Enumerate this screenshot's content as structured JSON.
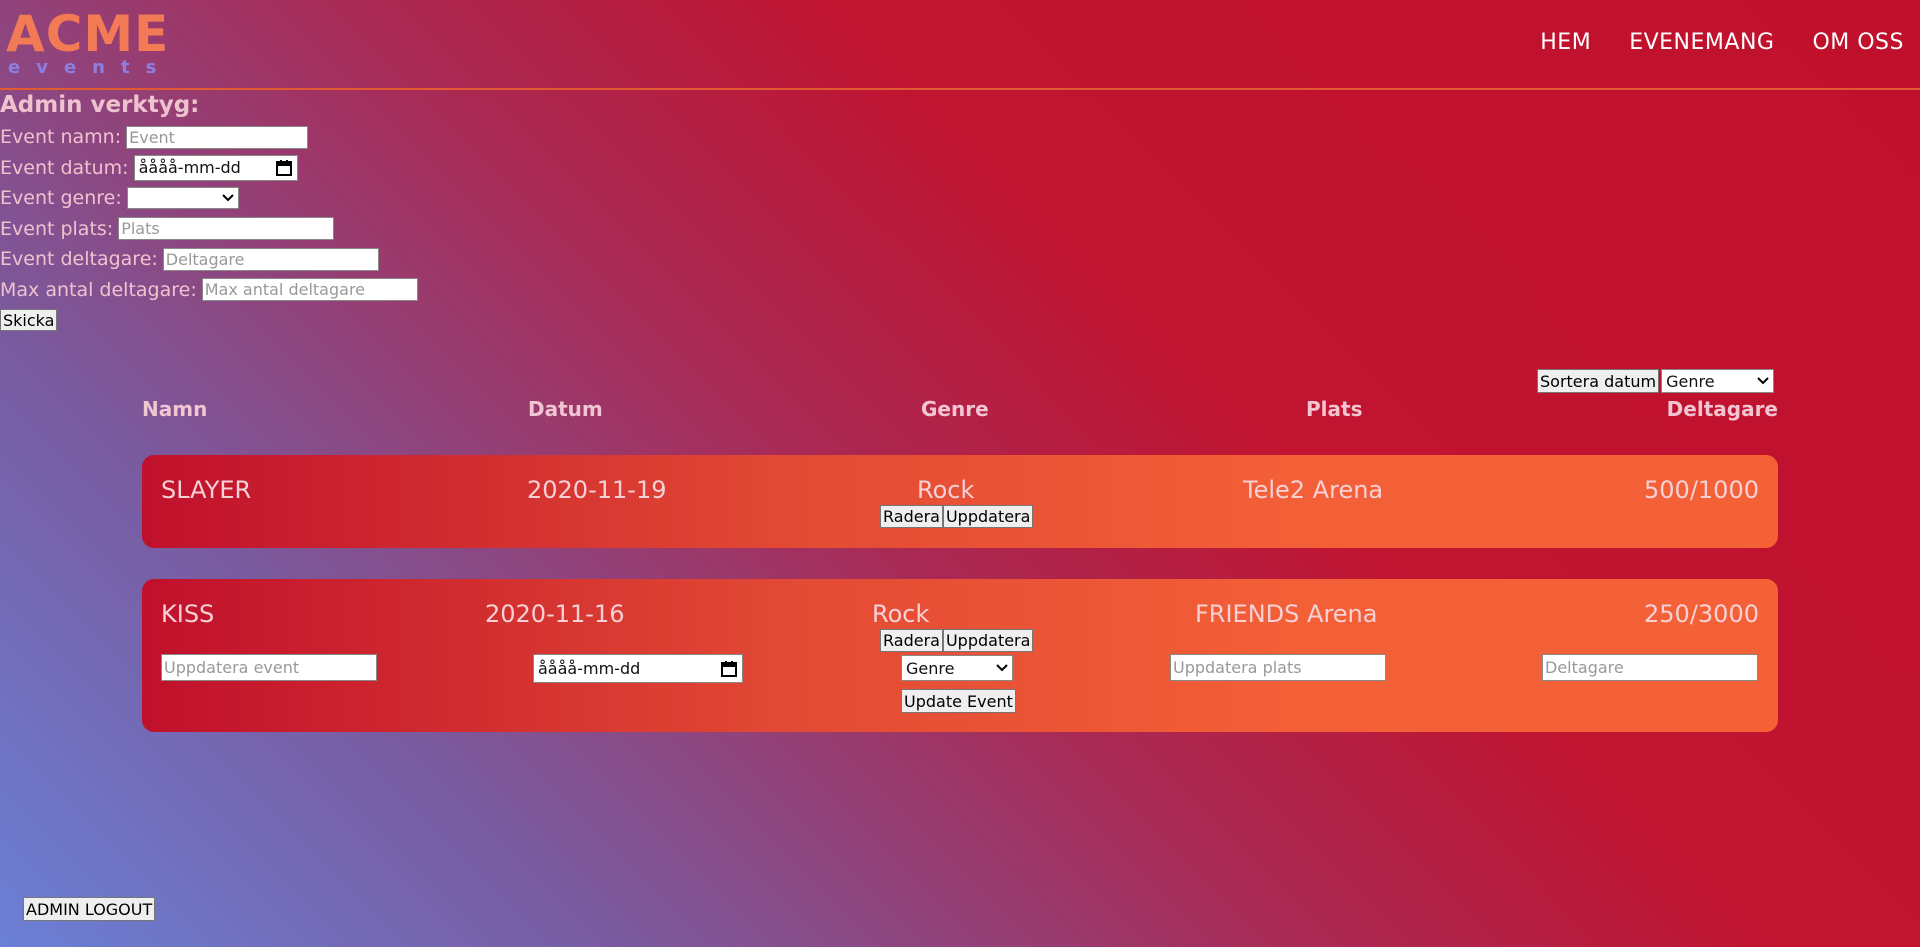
{
  "brand": {
    "logo_main": "ACME",
    "logo_sub": "events"
  },
  "nav": {
    "items": [
      "HEM",
      "EVENEMANG",
      "OM OSS"
    ]
  },
  "admin": {
    "title": "Admin verktyg:",
    "fields": {
      "name_label": "Event namn:",
      "name_placeholder": "Event",
      "date_label": "Event datum:",
      "date_value": "åååå-mm-dd",
      "genre_label": "Event genre:",
      "genre_value": "",
      "place_label": "Event plats:",
      "place_placeholder": "Plats",
      "participants_label": "Event deltagare:",
      "participants_placeholder": "Deltagare",
      "max_label": "Max antal deltagare:",
      "max_placeholder": "Max antal deltagare"
    },
    "submit_label": "Skicka"
  },
  "sort": {
    "date_button": "Sortera datum",
    "genre_select": "Genre"
  },
  "table": {
    "headers": {
      "name": "Namn",
      "date": "Datum",
      "genre": "Genre",
      "place": "Plats",
      "participants": "Deltagare"
    },
    "events": [
      {
        "name": "SLAYER",
        "date": "2020-11-19",
        "genre": "Rock",
        "place": "Tele2 Arena",
        "participants": "500/1000"
      },
      {
        "name": "KISS",
        "date": "2020-11-16",
        "genre": "Rock",
        "place": "FRIENDS Arena",
        "participants": "250/3000"
      }
    ],
    "delete_label": "Radera",
    "update_label": "Uppdatera"
  },
  "update_form": {
    "name_placeholder": "Uppdatera event",
    "date_value": "åååå-mm-dd",
    "genre_value": "Genre",
    "place_placeholder": "Uppdatera plats",
    "participants_placeholder": "Deltagare",
    "submit_label": "Update Event"
  },
  "logout_label": "ADMIN LOGOUT"
}
